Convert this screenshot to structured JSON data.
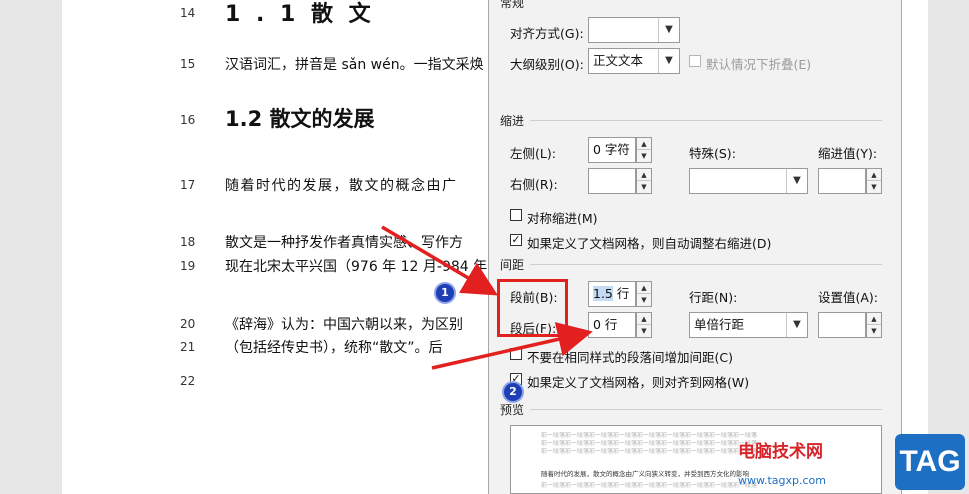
{
  "document": {
    "lines": [
      {
        "num": "14",
        "text": "1 . 1   散   文"
      },
      {
        "num": "15",
        "text": "汉语词汇，拼音是 sǎn wén。一指文采焕"
      },
      {
        "num": "16",
        "text": "1.2 散文的发展"
      },
      {
        "num": "17",
        "text": "随着时代的发展，散文的概念由广"
      },
      {
        "num": "18",
        "text": "散文是一种抒发作者真情实感、写作方"
      },
      {
        "num": "19",
        "text": "现在北宋太平兴国（976 年 12 月-984 年"
      },
      {
        "num": "20",
        "text": "《辞海》认为：中国六朝以来，为区别"
      },
      {
        "num": "21",
        "text": "（包括经传史书），统称“散文”。后"
      },
      {
        "num": "22",
        "text": ""
      }
    ]
  },
  "dialog": {
    "general": {
      "section_label": "常规",
      "alignment_label": "对齐方式(G):",
      "alignment_value": "",
      "outline_label": "大纲级别(O):",
      "outline_value": "正文文本",
      "collapse_label": "默认情况下折叠(E)"
    },
    "indent": {
      "section_label": "缩进",
      "left_label": "左侧(L):",
      "left_value": "0 字符",
      "right_label": "右侧(R):",
      "right_value": "",
      "special_label": "特殊(S):",
      "special_value": "",
      "by_label": "缩进值(Y):",
      "by_value": "",
      "mirror_label": "对称缩进(M)",
      "auto_adjust_label": "如果定义了文档网格，则自动调整右缩进(D)"
    },
    "spacing": {
      "section_label": "间距",
      "before_label": "段前(B):",
      "before_num": "1.5",
      "before_unit": " 行",
      "after_label": "段后(F):",
      "after_value": "0 行",
      "line_label": "行距(N):",
      "line_value": "单倍行距",
      "at_label": "设置值(A):",
      "at_value": "",
      "no_space_label": "不要在相同样式的段落间增加间距(C)",
      "snap_label": "如果定义了文档网格，则对齐到网格(W)"
    },
    "preview": {
      "section_label": "预览",
      "filler": "前一段落前一段落前一段落前一段落前一段落前一段落前一段落前一段落前一段落",
      "sample": "随着时代的发展，散文的概念由广义向狭义转变，并受到西方文化的影响"
    }
  },
  "annotations": {
    "badge1": "1",
    "badge2": "2"
  },
  "watermark": {
    "site_name": "电脑技术网",
    "url": "www.tagxp.com",
    "tag": "TAG"
  },
  "colors": {
    "highlight": "#e32020",
    "badge": "#1f3fb5",
    "watermark_red": "#d8232a",
    "tag_blue": "#1d6fc4"
  }
}
